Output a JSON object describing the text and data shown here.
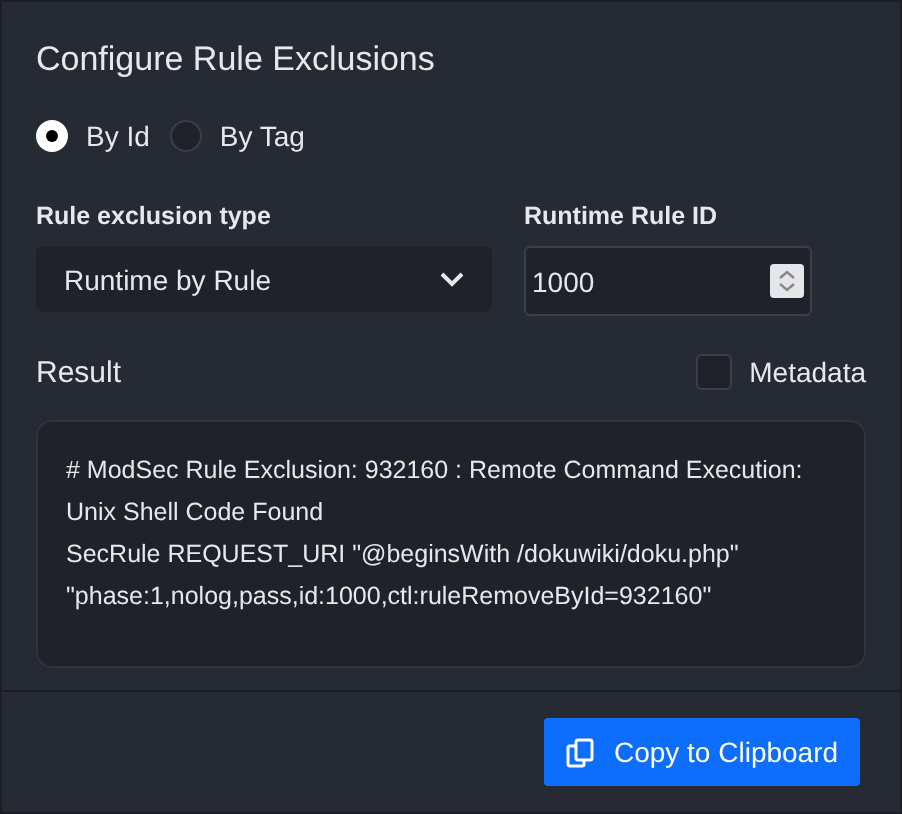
{
  "title": "Configure Rule Exclusions",
  "modes": [
    {
      "label": "By Id",
      "selected": true
    },
    {
      "label": "By Tag",
      "selected": false
    }
  ],
  "exclusion_type": {
    "label": "Rule exclusion type",
    "value": "Runtime by Rule"
  },
  "runtime_rule_id": {
    "label": "Runtime Rule ID",
    "value": "1000"
  },
  "result": {
    "label": "Result",
    "metadata": {
      "label": "Metadata",
      "checked": false
    },
    "lines": [
      "# ModSec Rule Exclusion: 932160 : Remote Command Execution:",
      "Unix Shell Code Found",
      "SecRule REQUEST_URI \"@beginsWith /dokuwiki/doku.php\"",
      "\"phase:1,nolog,pass,id:1000,ctl:ruleRemoveById=932160\""
    ]
  },
  "copy_button": "Copy to Clipboard"
}
